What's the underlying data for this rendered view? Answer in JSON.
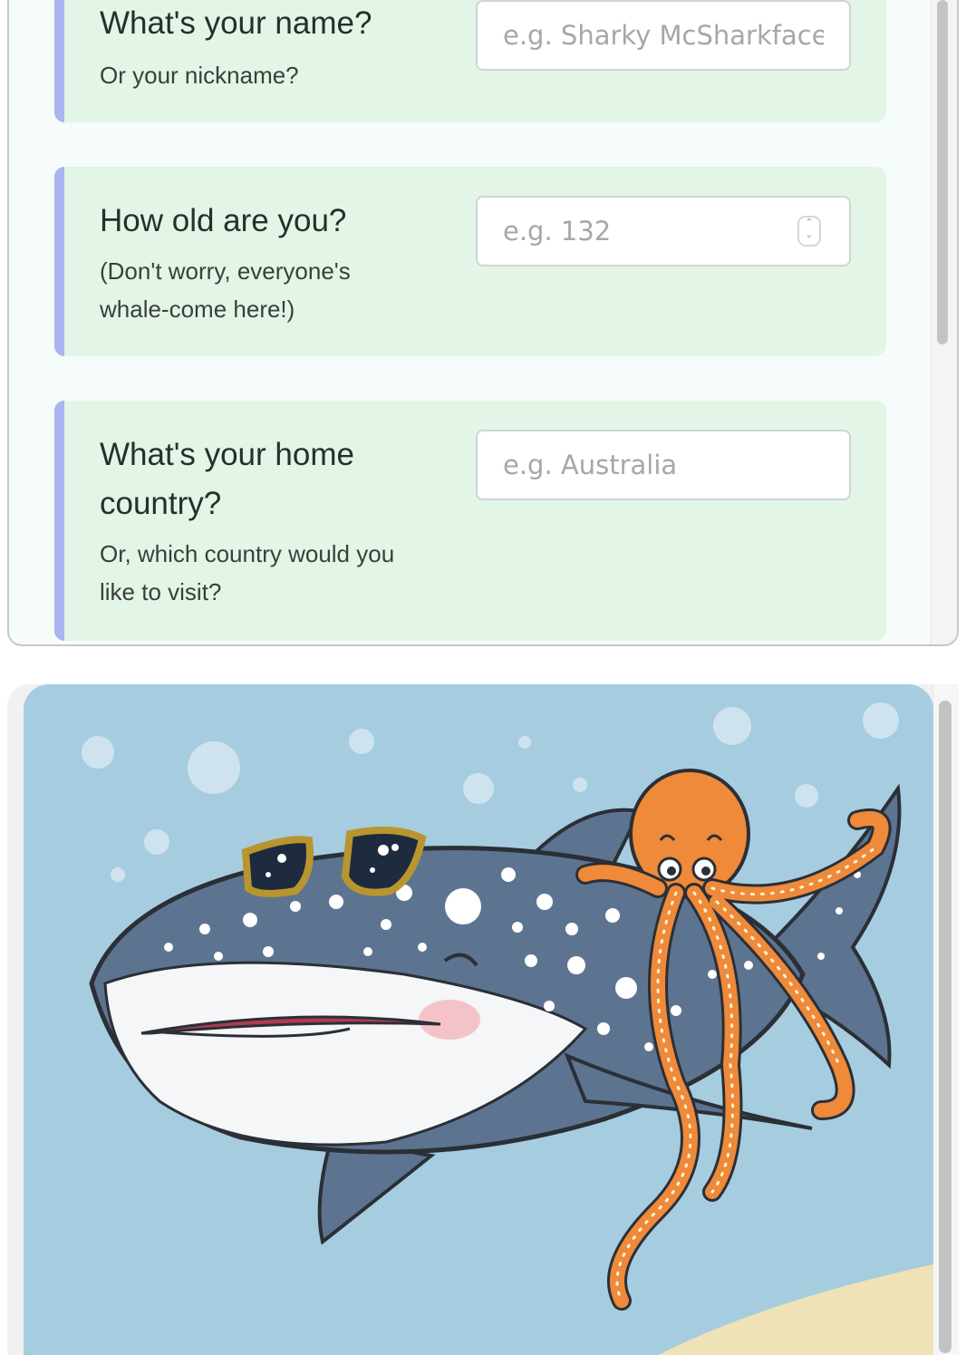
{
  "form": {
    "questions": [
      {
        "question": "What's your name?",
        "hint": "Or your nickname?",
        "placeholder": "e.g. Sharky McSharkface",
        "input_type": "text"
      },
      {
        "question": "How old are you?",
        "hint_lines": [
          "(Don't worry, everyone's",
          "whale-come here!)"
        ],
        "placeholder": "e.g. 132",
        "input_type": "number"
      },
      {
        "question_lines": [
          "What's your home",
          "country?"
        ],
        "hint_lines": [
          "Or, which country would you",
          "like to visit?"
        ],
        "placeholder": "e.g. Australia",
        "input_type": "text"
      }
    ]
  },
  "illustration": {
    "subject": "whale shark wearing sunglasses with an orange octopus riding on its back",
    "colors": {
      "water": "#a6cce0",
      "shark": "#5c7490",
      "octopus": "#ee8a3a",
      "sand": "#efe2b6"
    }
  },
  "theme": {
    "card_bg": "#e3f5e6",
    "accent_bar": "#aab4f0",
    "panel_bg": "#f5fcf9"
  }
}
